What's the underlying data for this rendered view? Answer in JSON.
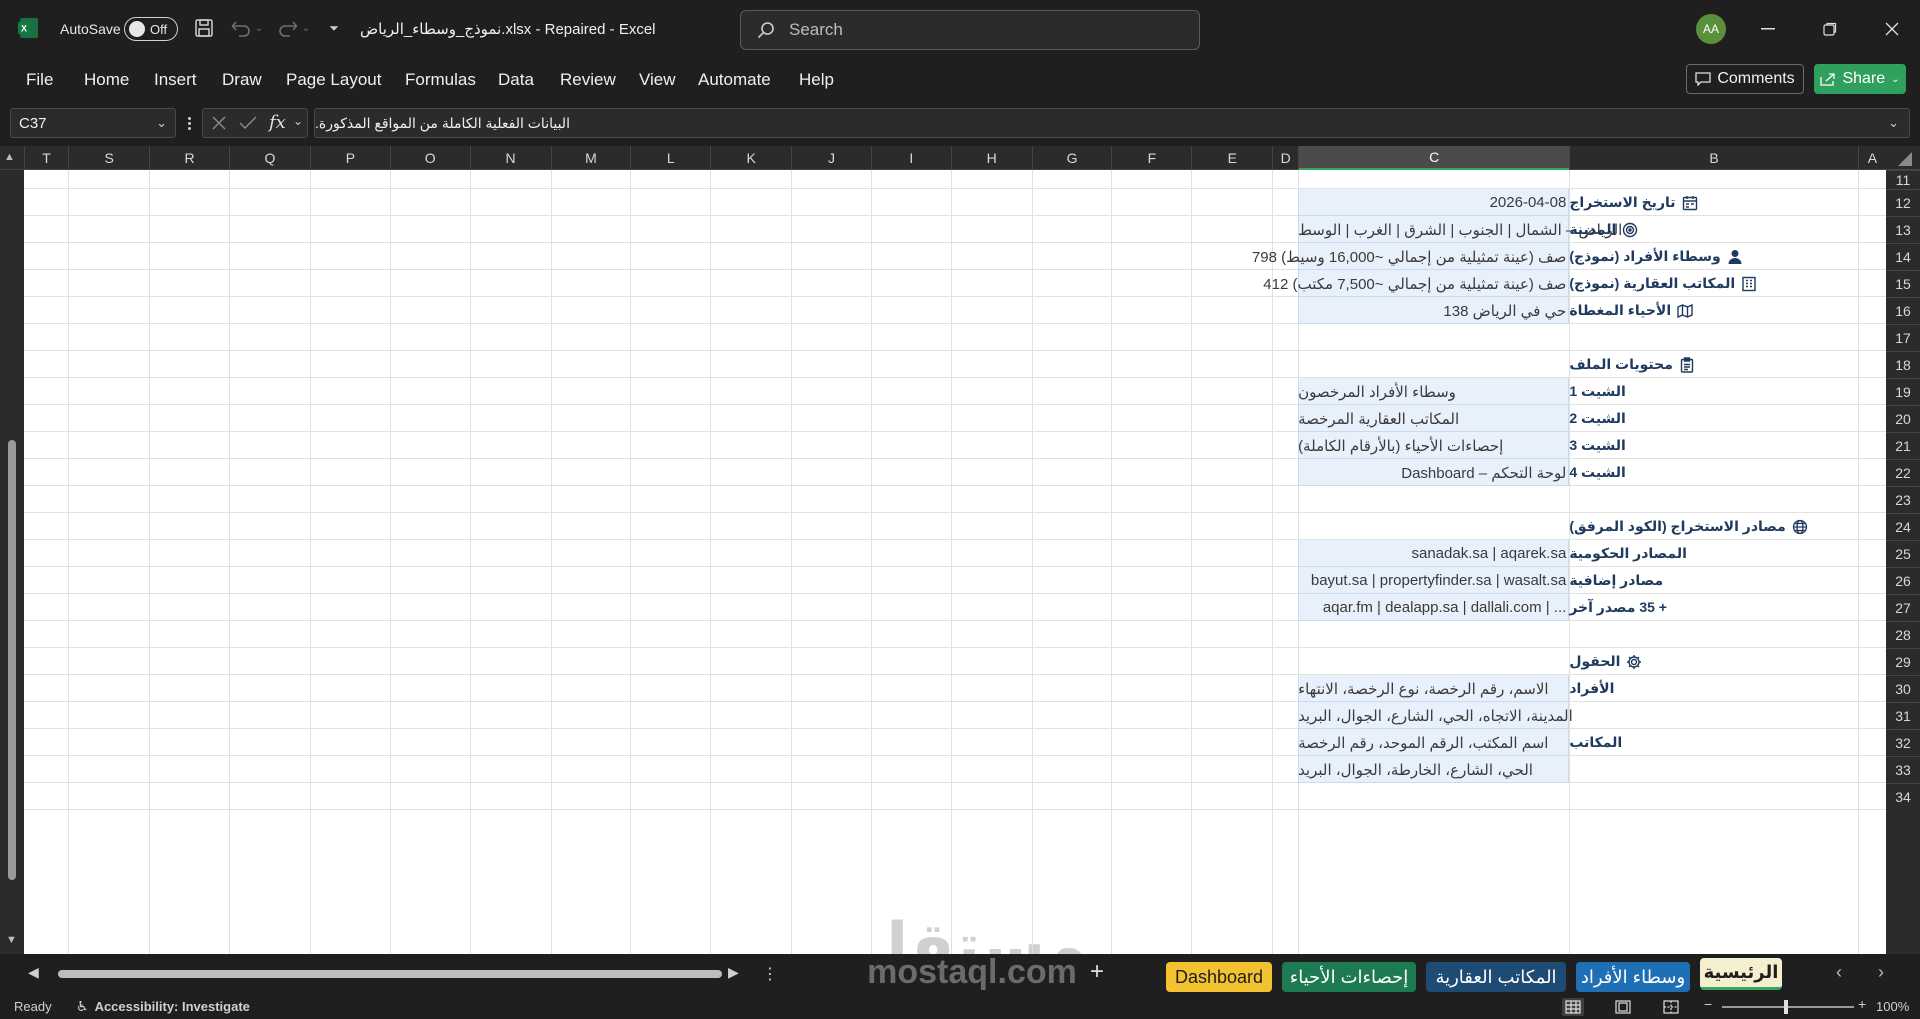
{
  "title_bar": {
    "autosave_label": "AutoSave",
    "autosave_state": "Off",
    "doc_title": "نموذج_وسطاء_الرياض.xlsx  -  Repaired  -  Excel",
    "search_placeholder": "Search",
    "user_initials": "AA"
  },
  "ribbon": {
    "tabs": [
      "File",
      "Home",
      "Insert",
      "Draw",
      "Page Layout",
      "Formulas",
      "Data",
      "Review",
      "View",
      "Automate",
      "Help"
    ],
    "comments_label": "Comments",
    "share_label": "Share"
  },
  "formula_bar": {
    "name_box": "C37",
    "fx": "fx",
    "content": "البيانات الفعلية الكاملة من المواقع المذكورة."
  },
  "columns": [
    "T",
    "S",
    "R",
    "Q",
    "P",
    "O",
    "N",
    "M",
    "L",
    "K",
    "J",
    "I",
    "H",
    "G",
    "F",
    "E",
    "D",
    "C",
    "B",
    "A"
  ],
  "rows": [
    "11",
    "12",
    "13",
    "14",
    "15",
    "16",
    "17",
    "18",
    "19",
    "20",
    "21",
    "22",
    "23",
    "24",
    "25",
    "26",
    "27",
    "28",
    "29",
    "30",
    "31",
    "32",
    "33",
    "34"
  ],
  "cells": {
    "r12": {
      "label": "تاريخ الاستخراج",
      "value": "2026-04-08",
      "icon": "calendar-icon"
    },
    "r13": {
      "label": "المدينة",
      "value": "الرياض – الشمال | الجنوب | الشرق | الغرب | الوسط",
      "icon": "target-icon"
    },
    "r14": {
      "label": "وسطاء الأفراد (نموذج)",
      "value": "798 صف (عينة تمثيلية من إجمالي ~16,000 وسيط)",
      "icon": "person-icon"
    },
    "r15": {
      "label": "المكاتب العقارية (نموذج)",
      "value": "412 صف (عينة تمثيلية من إجمالي ~7,500 مكتب)",
      "icon": "building-icon"
    },
    "r16": {
      "label": "الأحياء المغطاة",
      "value": "138 حي في الرياض",
      "icon": "map-icon"
    },
    "r18": {
      "label": "محتويات الملف",
      "icon": "clipboard-icon"
    },
    "r19": {
      "label": "الشيت 1",
      "value": "وسطاء الأفراد المرخصون"
    },
    "r20": {
      "label": "الشيت 2",
      "value": "المكاتب العقارية المرخصة"
    },
    "r21": {
      "label": "الشيت 3",
      "value": "إحصاءات الأحياء (بالأرقام الكاملة)"
    },
    "r22": {
      "label": "الشيت 4",
      "value": "Dashboard – لوحة التحكم"
    },
    "r24": {
      "label": "مصادر الاستخراج (الكود المرفق)",
      "icon": "globe-icon"
    },
    "r25": {
      "label": "المصادر الحكومية",
      "value": "sanadak.sa | aqarek.sa"
    },
    "r26": {
      "label": "مصادر إضافية",
      "value": "bayut.sa | propertyfinder.sa | wasalt.sa"
    },
    "r27": {
      "label": "+ 35 مصدر آخر",
      "value": "aqar.fm | dealapp.sa | dallali.com | ..."
    },
    "r29": {
      "label": "الحقول",
      "icon": "gear-icon"
    },
    "r30": {
      "label": "الأفراد",
      "value": "الاسم، رقم الرخصة، نوع الرخصة، الانتهاء"
    },
    "r31": {
      "value": "المدينة، الاتجاه، الحي، الشارع، الجوال، البريد"
    },
    "r32": {
      "label": "المكاتب",
      "value": "اسم المكتب، الرقم الموحد، رقم الرخصة"
    },
    "r33": {
      "value": "الحي، الشارع، الخارطة، الجوال، البريد"
    }
  },
  "watermark": {
    "arabic": "مستقل",
    "latin": "mostaql.com"
  },
  "sheet_tabs": [
    {
      "label": "الرئيسية",
      "active": true,
      "color": "#f5efcf"
    },
    {
      "label": "وسطاء الأفراد",
      "active": false,
      "color": "#1f6fb5"
    },
    {
      "label": "المكاتب العقارية",
      "active": false,
      "color": "#1d4b73"
    },
    {
      "label": "إحصاءات الأحياء",
      "active": false,
      "color": "#1e7a52"
    },
    {
      "label": "Dashboard",
      "active": false,
      "color": "#f2c230"
    }
  ],
  "status_bar": {
    "ready": "Ready",
    "accessibility": "Accessibility: Investigate",
    "zoom": "100%"
  },
  "colors": {
    "accent_green": "#3aa35f",
    "selection_fill": "#e8f1fb",
    "label_text": "#1e3a5f"
  }
}
